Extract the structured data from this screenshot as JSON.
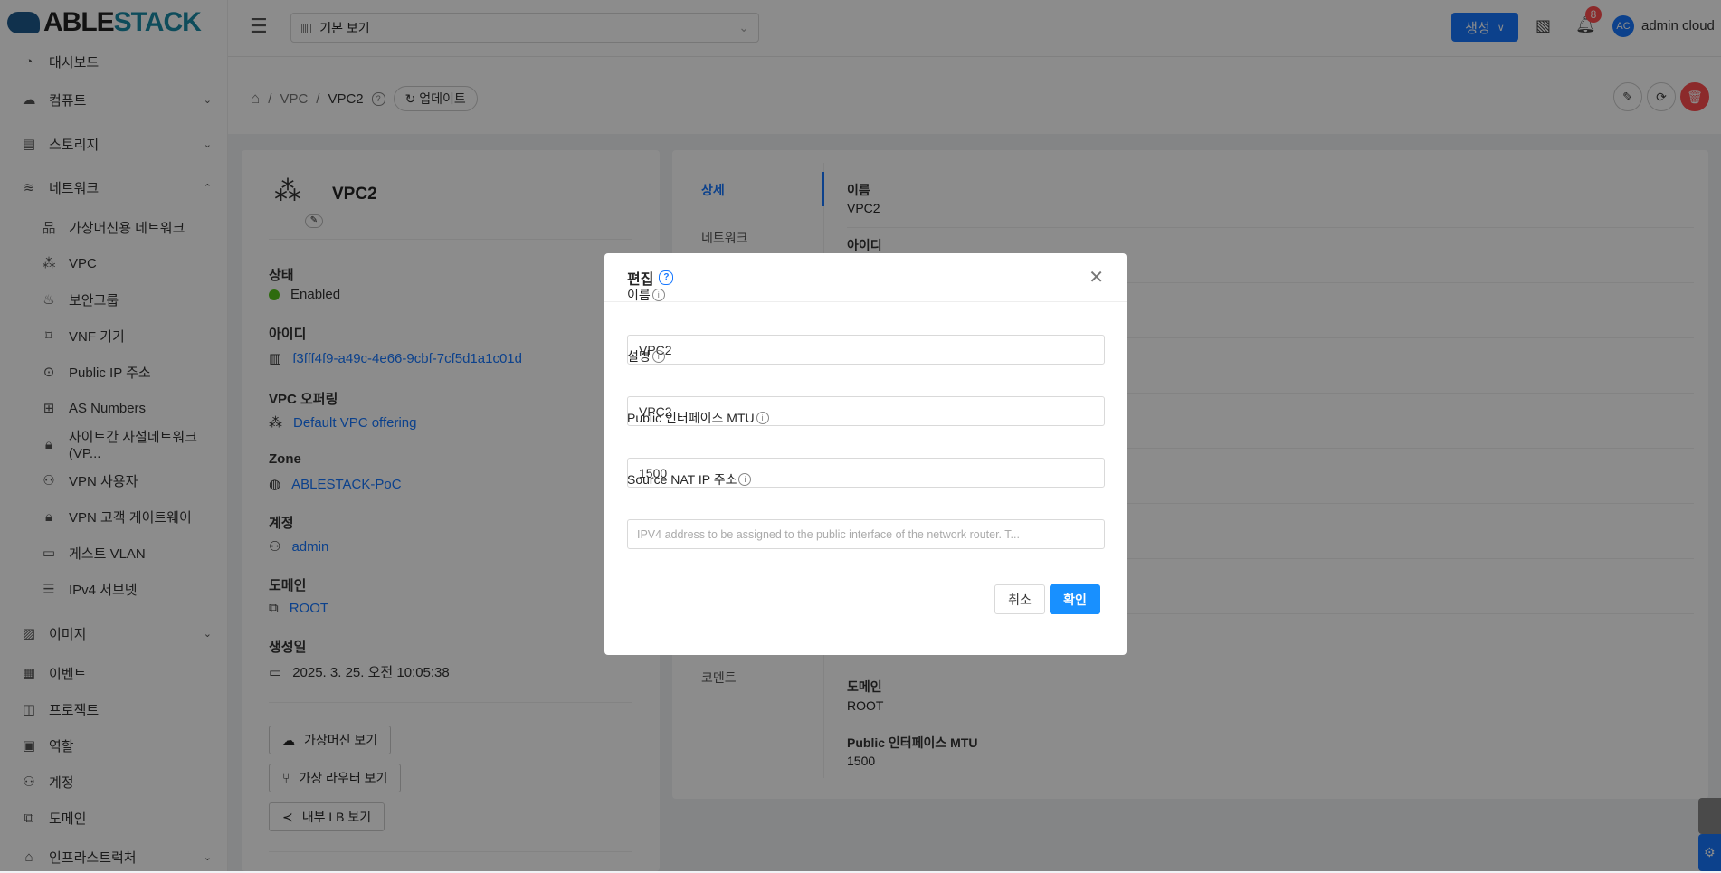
{
  "app": {
    "logo_a": "ABLE",
    "logo_b": "STACK"
  },
  "sidebar": {
    "items": [
      {
        "label": "대시보드",
        "icon": "dashboard-icon",
        "g": "◔"
      },
      {
        "label": "컴퓨트",
        "icon": "cloud-icon",
        "g": "☁",
        "chev": "⌄"
      },
      {
        "label": "스토리지",
        "icon": "storage-icon",
        "g": "▤",
        "chev": "⌄"
      },
      {
        "label": "네트워크",
        "icon": "wifi-icon",
        "g": "≋",
        "chev": "⌃"
      },
      {
        "label": "가상머신용 네트워크",
        "icon": "network-icon",
        "g": "品",
        "sub": true
      },
      {
        "label": "VPC",
        "icon": "vpc-icon",
        "g": "⁂",
        "sub": true
      },
      {
        "label": "보안그룹",
        "icon": "fire-icon",
        "g": "♨",
        "sub": true
      },
      {
        "label": "VNF 기기",
        "icon": "vnf-icon",
        "g": "⌑",
        "sub": true
      },
      {
        "label": "Public IP 주소",
        "icon": "location-icon",
        "g": "⊙",
        "sub": true
      },
      {
        "label": "AS Numbers",
        "icon": "cluster-icon",
        "g": "⊞",
        "sub": true
      },
      {
        "label": "사이트간 사설네트워크(VP...",
        "icon": "lock-icon",
        "g": "🔒︎",
        "sub": true
      },
      {
        "label": "VPN 사용자",
        "icon": "user-switch-icon",
        "g": "⚇",
        "sub": true
      },
      {
        "label": "VPN 고객 게이트웨이",
        "icon": "lock-icon",
        "g": "🔒︎",
        "sub": true
      },
      {
        "label": "게스트 VLAN",
        "icon": "folder-icon",
        "g": "▭",
        "sub": true
      },
      {
        "label": "IPv4 서브넷",
        "icon": "subnet-icon",
        "g": "☰",
        "sub": true
      },
      {
        "label": "이미지",
        "icon": "picture-icon",
        "g": "▨",
        "chev": "⌄"
      },
      {
        "label": "이벤트",
        "icon": "schedule-icon",
        "g": "▦"
      },
      {
        "label": "프로젝트",
        "icon": "project-icon",
        "g": "◫"
      },
      {
        "label": "역할",
        "icon": "idcard-icon",
        "g": "▣"
      },
      {
        "label": "계정",
        "icon": "team-icon",
        "g": "⚇"
      },
      {
        "label": "도메인",
        "icon": "block-icon",
        "g": "⧉"
      },
      {
        "label": "인프라스트럭처",
        "icon": "bank-icon",
        "g": "⌂",
        "chev": "⌄"
      }
    ]
  },
  "header": {
    "view": "기본 보기",
    "create": "생성",
    "notifications": "8",
    "avatar": "AC",
    "user": "admin cloud"
  },
  "breadcrumb": {
    "items": [
      "VPC",
      "VPC2"
    ],
    "update": "업데이트"
  },
  "info": {
    "name": "VPC2",
    "status_label": "상태",
    "status": "Enabled",
    "status_color": "#52c41a",
    "id_label": "아이디",
    "id": "f3fff4f9-a49c-4e66-9cbf-7cf5d1a1c01d",
    "offering_label": "VPC 오퍼링",
    "offering": "Default VPC offering",
    "zone_label": "Zone",
    "zone": "ABLESTACK-PoC",
    "account_label": "계정",
    "account": "admin",
    "domain_label": "도메인",
    "domain": "ROOT",
    "created_label": "생성일",
    "created": "2025. 3. 25. 오전 10:05:38",
    "buttons": [
      "가상머신 보기",
      "가상 라우터 보기",
      "내부 LB 보기"
    ]
  },
  "tabs": [
    "상세",
    "네트워크",
    "코멘트"
  ],
  "details": [
    {
      "label": "이름",
      "value": "VPC2"
    },
    {
      "label": "아이디",
      "value": ""
    },
    {
      "label": "도메인",
      "value": "ROOT"
    },
    {
      "label": "Public 인터페이스 MTU",
      "value": "1500"
    }
  ],
  "dialog": {
    "title": "편집",
    "fields": [
      {
        "label": "이름",
        "value": "VPC2",
        "placeholder": ""
      },
      {
        "label": "설명",
        "value": "VPC2",
        "placeholder": ""
      },
      {
        "label": "Public 인터페이스 MTU",
        "value": "1500",
        "placeholder": ""
      },
      {
        "label": "Source NAT IP 주소",
        "value": "",
        "placeholder": "IPV4 address to be assigned to the public interface of the network router. T..."
      }
    ],
    "cancel": "취소",
    "ok": "확인"
  }
}
